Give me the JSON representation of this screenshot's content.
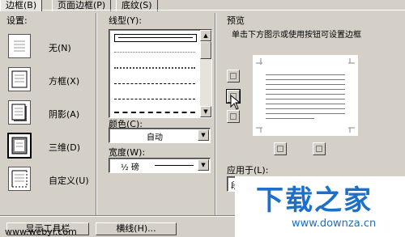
{
  "tabs": [
    {
      "label": "边框(B)"
    },
    {
      "label": "页面边框(P)"
    },
    {
      "label": "底纹(S)"
    }
  ],
  "setting": {
    "label": "设置:",
    "items": [
      {
        "label": "无(N)",
        "icon": "border-none-icon"
      },
      {
        "label": "方框(X)",
        "icon": "border-box-icon"
      },
      {
        "label": "阴影(A)",
        "icon": "border-shadow-icon"
      },
      {
        "label": "三维(D)",
        "icon": "border-3d-icon"
      },
      {
        "label": "自定义(U)",
        "icon": "border-custom-icon"
      }
    ],
    "selected_index": 3
  },
  "style": {
    "label": "线型(Y):",
    "line_styles": [
      "solid",
      "dotted-fine",
      "dotted",
      "dashed",
      "dash-dot",
      "dashed-long"
    ],
    "selected_index": 0
  },
  "color": {
    "label": "颜色(C):",
    "value": "自动"
  },
  "width": {
    "label": "宽度(W):",
    "value": "½ 磅"
  },
  "preview": {
    "label": "预览",
    "hint": "单击下方图示或使用按钮可设置边框"
  },
  "apply_to": {
    "label": "应用于(L):",
    "value": "段"
  },
  "buttons": {
    "show_toolbar": "显示工具栏",
    "horizontal_line": "横线(H)..."
  },
  "watermark": {
    "brand": "下载之家",
    "site": "www.downza.cn",
    "url": "www.webyi.com"
  },
  "colors": {
    "accent": "#1d6fc8",
    "dialog_bg": "#d4d0c8"
  }
}
